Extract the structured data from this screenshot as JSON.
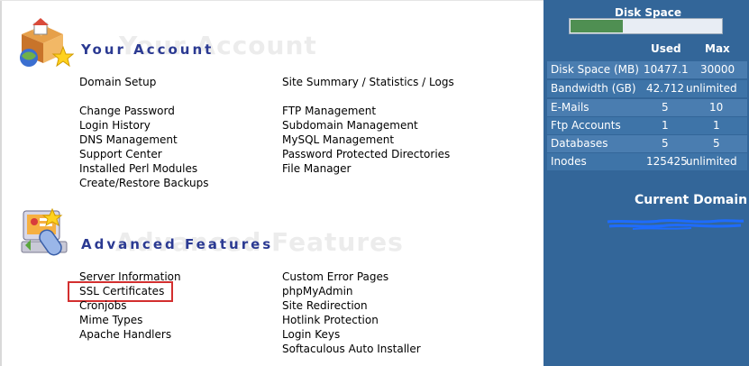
{
  "your_account": {
    "title": "Your Account",
    "ghost": "Your Account",
    "links_top": [
      "Domain Setup"
    ],
    "links_left": [
      "Change Password",
      "Login History",
      "DNS Management",
      "Support Center",
      "Installed Perl Modules",
      "Create/Restore Backups"
    ],
    "links_right_top": [
      "Site Summary / Statistics / Logs"
    ],
    "links_right": [
      "FTP Management",
      "Subdomain Management",
      "MySQL Management",
      "Password Protected Directories",
      "File Manager"
    ]
  },
  "advanced": {
    "title": "Advanced Features",
    "ghost": "Advanced Features",
    "links_left": [
      "Server Information",
      "SSL Certificates",
      "Cronjobs",
      "Mime Types",
      "Apache Handlers"
    ],
    "links_right": [
      "Custom Error Pages",
      "phpMyAdmin",
      "Site Redirection",
      "Hotlink Protection",
      "Login Keys",
      "Softaculous Auto Installer"
    ]
  },
  "sidebar": {
    "disk_space_title": "Disk Space",
    "disk_usage_fraction": 0.35,
    "col_used": "Used",
    "col_max": "Max",
    "stats": [
      {
        "label": "Disk Space (MB)",
        "used": "10477.1",
        "max": "30000"
      },
      {
        "label": "Bandwidth (GB)",
        "used": "42.712",
        "max": "unlimited"
      },
      {
        "label": "E-Mails",
        "used": "5",
        "max": "10"
      },
      {
        "label": "Ftp Accounts",
        "used": "1",
        "max": "1"
      },
      {
        "label": "Databases",
        "used": "5",
        "max": "5"
      },
      {
        "label": "Inodes",
        "used": "125425",
        "max": "unlimited"
      }
    ],
    "current_domain_title": "Current Domain"
  },
  "colors": {
    "sidebar_bg": "#336699",
    "title_blue": "#2b3a92",
    "highlight_red": "#d32f2f",
    "progress_green": "#4f8f52"
  }
}
